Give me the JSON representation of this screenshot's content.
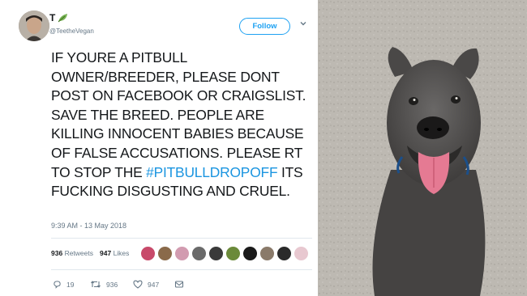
{
  "tweet": {
    "name": "T",
    "handle": "@TeetheVegan",
    "follow_label": "Follow",
    "text": {
      "line1": "IF YOURE A PITBULL",
      "line2": "OWNER/BREEDER, PLEASE DONT",
      "line3": "POST ON FACEBOOK OR CRAIGSLIST.",
      "line4": "SAVE THE BREED. PEOPLE ARE",
      "line5": "KILLING INNOCENT BABIES BECAUSE",
      "line6": "OF FALSE ACCUSATIONS. PLEASE RT",
      "line7a": "TO STOP THE ",
      "hashtag": "#PITBULLDROPOFF",
      "line7b": " ITS",
      "line8": "FUCKING DISGUSTING AND CRUEL."
    },
    "timestamp": "9:39 AM - 13 May 2018",
    "retweets_count": "936",
    "retweets_label": "Retweets",
    "likes_count": "947",
    "likes_label": "Likes",
    "liker_colors": [
      "#c84a6a",
      "#8a6a4a",
      "#d29bb0",
      "#6a6a6a",
      "#3a3a3a",
      "#6b8a3a",
      "#1a1a1a",
      "#8a7a6a",
      "#2a2a2a",
      "#e8c8d0"
    ],
    "actions": {
      "reply_count": "19",
      "retweet_count": "936",
      "like_count": "947"
    }
  },
  "icons": [
    "leaf-emoji-icon",
    "chevron-down-icon",
    "reply-icon",
    "retweet-icon",
    "heart-icon",
    "message-icon"
  ],
  "colors": {
    "accent": "#1da1f2",
    "hashtag": "#1b95e0",
    "text": "#14171a",
    "muted": "#657786"
  }
}
